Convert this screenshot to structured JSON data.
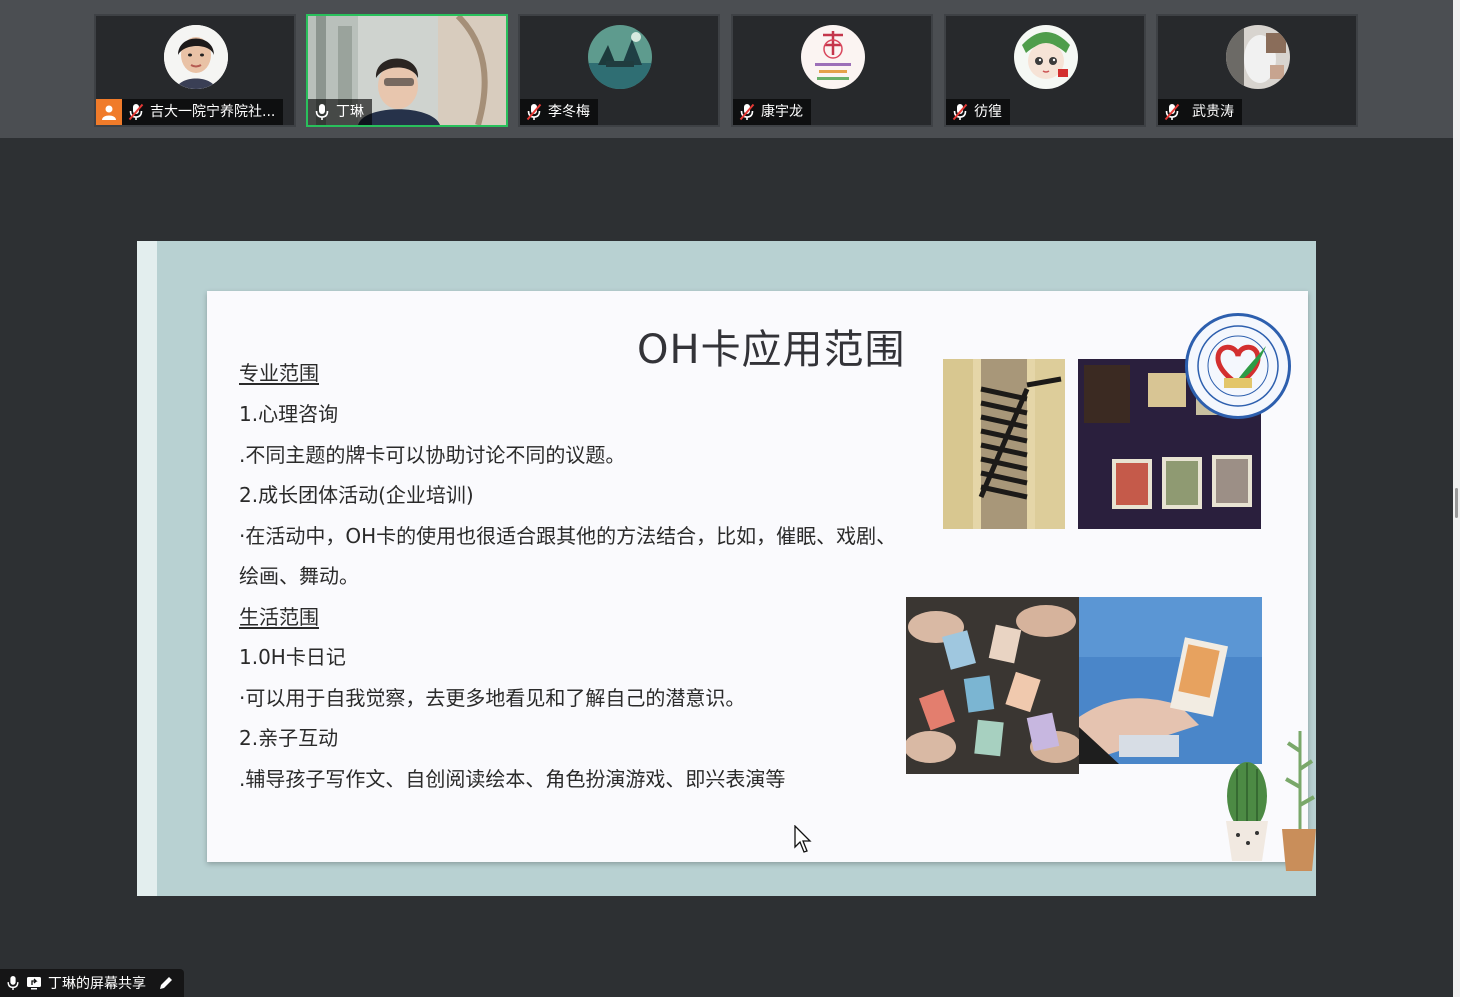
{
  "participants": [
    {
      "name": "吉大一院宁养院社...",
      "mic": "muted",
      "host_badge": true,
      "active": false,
      "avatar": "photo-woman"
    },
    {
      "name": "丁琳",
      "mic": "on",
      "host_badge": false,
      "active": true,
      "avatar": "video-feed"
    },
    {
      "name": "李冬梅",
      "mic": "muted",
      "host_badge": false,
      "active": false,
      "avatar": "landscape"
    },
    {
      "name": "康宇龙",
      "mic": "muted",
      "host_badge": false,
      "active": false,
      "avatar": "calligraphy"
    },
    {
      "name": "彷徨",
      "mic": "muted",
      "host_badge": false,
      "active": false,
      "avatar": "cartoon-character"
    },
    {
      "name": "武贵涛",
      "mic": "muted",
      "host_badge": false,
      "active": false,
      "avatar": "photo-device"
    }
  ],
  "slide": {
    "title": "OH卡应用范围",
    "lines": [
      "专业范围",
      "1.心理咨询",
      ".不同主题的牌卡可以协助讨论不同的议题。",
      "2.成长团体活动(企业培训)",
      "·在活动中，OH卡的使用也很适合跟其他的方法结合，比如，催眠、戏剧、",
      "绘画、舞动。",
      "生活范围",
      "1.0H卡日记",
      "·可以用于自我觉察，去更多地看见和了解自己的潜意识。",
      "2.亲子互动",
      ".辅导孩子写作文、自创阅读绘本、角色扮演游戏、即兴表演等"
    ]
  },
  "screenshare": {
    "label": "丁琳的屏幕共享"
  },
  "colors": {
    "active_border": "#29c05c",
    "host_badge": "#f07b2a",
    "slide_frame": "#b8d1d2",
    "seal_blue": "#2d5fae"
  },
  "icons": {
    "mic_muted": "mic-muted-icon",
    "mic_on": "mic-icon",
    "share": "screen-share-icon",
    "edit": "pencil-icon",
    "cursor": "mouse-pointer-icon"
  }
}
